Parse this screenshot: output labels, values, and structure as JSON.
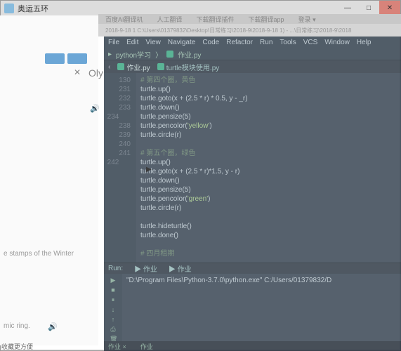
{
  "tk": {
    "title": "奥运五环",
    "min": "—",
    "max": "□",
    "close": "✕"
  },
  "top_strip": [
    "百度AI翻译机",
    "人工翻译",
    "下载翻译插件",
    "下载翻译app",
    "登录 ▾"
  ],
  "addr": "2018-9-18 1 C:\\Users\\01379832\\Desktop\\日常练习\\2018-9\\2018-9-18 1) - ...\\日常练习\\2018-9\\2018",
  "ide": {
    "menu": [
      "File",
      "Edit",
      "View",
      "Navigate",
      "Code",
      "Refactor",
      "Run",
      "Tools",
      "VCS",
      "Window",
      "Help"
    ],
    "crumb": [
      "python学习",
      "作业.py"
    ],
    "tabs": [
      {
        "label": "作业.py",
        "active": true
      },
      {
        "label": "turtle模块使用.py",
        "active": false
      }
    ],
    "lines": [
      {
        "n": "",
        "t": "# 第四个圈，黄色",
        "cls": "c-cm"
      },
      {
        "n": "",
        "t": "turtle.up()"
      },
      {
        "n": "130",
        "t": "turtle.goto(x + (2.5 * r) * 0.5, y - _r)"
      },
      {
        "n": "231",
        "t": "turtle.down()"
      },
      {
        "n": "232",
        "t": "turtle.pensize(5)"
      },
      {
        "n": "233",
        "t": "turtle.pencolor('yellow')"
      },
      {
        "n": "234",
        "t": "turtle.circle(r)"
      },
      {
        "n": "",
        "t": ""
      },
      {
        "n": "",
        "t": "# 第五个圈，绿色",
        "cls": "c-cm"
      },
      {
        "n": "",
        "t": "turtle.up()"
      },
      {
        "n": "238",
        "t": "turtle.goto(x + (2.5 * r)*1.5, y - r)"
      },
      {
        "n": "239",
        "t": "turtle.down()"
      },
      {
        "n": "240",
        "t": "turtle.pensize(5)"
      },
      {
        "n": "241",
        "t": "turtle.pencolor('green')"
      },
      {
        "n": "242",
        "t": "turtle.circle(r)"
      },
      {
        "n": "",
        "t": ""
      },
      {
        "n": "",
        "t": "turtle.hideturtle()"
      },
      {
        "n": "",
        "t": "turtle.done()"
      },
      {
        "n": "",
        "t": ""
      },
      {
        "n": "",
        "t": "# 四月租期",
        "cls": "c-cm"
      }
    ],
    "run_hdr": {
      "label": "Run:",
      "tab1": "作业",
      "tab2": "作业"
    },
    "run_out": "\"D:\\Program Files\\Python-3.7.0\\python.exe\" C:/Users/01379832/D",
    "status": [
      "作业 ×",
      "作业",
      "▶"
    ]
  },
  "bg": {
    "oly": "Oly",
    "x": "✕",
    "stamps": "e stamps of the Winter",
    "mic": "mic ring.",
    "snd1": "🔊",
    "snd2": "🔊"
  },
  "bottom": "收藏更方便"
}
